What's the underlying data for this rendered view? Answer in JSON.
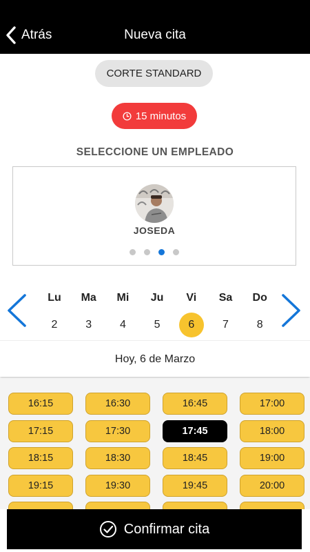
{
  "header": {
    "back_label": "Atrás",
    "title": "Nueva cita"
  },
  "service": {
    "name": "CORTE STANDARD"
  },
  "duration": {
    "label": "15 minutos"
  },
  "employee_section": {
    "title": "SELECCIONE UN EMPLEADO"
  },
  "employee": {
    "name": "JOSEDA",
    "carousel_page": 3,
    "carousel_pages": 4
  },
  "week": {
    "days": [
      {
        "name": "Lu",
        "number": "2"
      },
      {
        "name": "Ma",
        "number": "3"
      },
      {
        "name": "Mi",
        "number": "4"
      },
      {
        "name": "Ju",
        "number": "5"
      },
      {
        "name": "Vi",
        "number": "6",
        "selected": true
      },
      {
        "name": "Sa",
        "number": "7"
      },
      {
        "name": "Do",
        "number": "8"
      }
    ]
  },
  "selected_date": {
    "label": "Hoy, 6 de Marzo"
  },
  "time_slots": [
    "16:15",
    "16:30",
    "16:45",
    "17:00",
    "17:15",
    "17:30",
    "17:45",
    "18:00",
    "18:15",
    "18:30",
    "18:45",
    "19:00",
    "19:15",
    "19:30",
    "19:45",
    "20:00"
  ],
  "selected_time": "17:45",
  "confirm": {
    "label": "Confirmar cita"
  },
  "colors": {
    "header_bg": "#000000",
    "accent_yellow": "#f7c32e",
    "duration_red": "#f23b3b",
    "nav_blue": "#1476d9",
    "selected_slot": "#000000"
  }
}
